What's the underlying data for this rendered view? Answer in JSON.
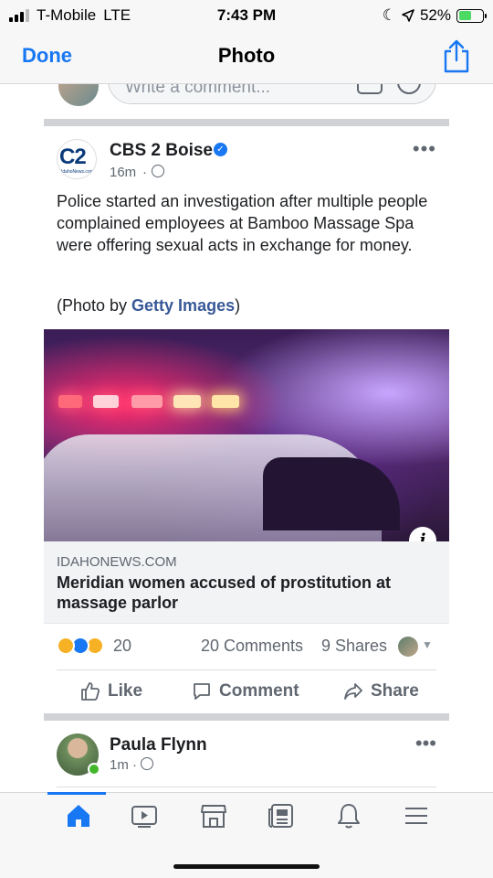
{
  "status_bar": {
    "carrier": "T-Mobile",
    "network": "LTE",
    "time": "7:43 PM",
    "battery": "52%",
    "battery_level": 0.52,
    "icons": [
      "signal-icon",
      "moon-icon",
      "location-icon",
      "battery-charging-icon"
    ]
  },
  "nav": {
    "done_label": "Done",
    "title": "Photo",
    "share_icon": "share-icon"
  },
  "comment_box": {
    "placeholder": "Write a comment..."
  },
  "post": {
    "author": "CBS 2 Boise",
    "avatar_text": "C2",
    "avatar_sub": "IdahoNews.com",
    "verified": true,
    "time": "16m",
    "text": "Police started an investigation after multiple people complained employees at Bamboo Massage Spa were offering sexual acts in exchange for money.",
    "credit_prefix": "(Photo by ",
    "credit_link": "Getty Images",
    "credit_suffix": ")",
    "link": {
      "domain": "IDAHONEWS.COM",
      "title": "Meridian women accused of prostitution at massage parlor"
    },
    "reactions": {
      "types": [
        "haha",
        "like",
        "wow"
      ],
      "count": "20",
      "comments": "20 Comments",
      "shares": "9 Shares"
    },
    "actions": {
      "like": "Like",
      "comment": "Comment",
      "share": "Share"
    }
  },
  "post2": {
    "author": "Paula Flynn",
    "time": "1m",
    "online": true
  },
  "tabs": [
    {
      "name": "home",
      "active": true
    },
    {
      "name": "watch",
      "active": false
    },
    {
      "name": "marketplace",
      "active": false
    },
    {
      "name": "news",
      "active": false
    },
    {
      "name": "notifications",
      "active": false
    },
    {
      "name": "menu",
      "active": false
    }
  ],
  "colors": {
    "accent": "#1877f2",
    "link": "#385898",
    "secondary_text": "#606770",
    "online": "#42b72a"
  }
}
